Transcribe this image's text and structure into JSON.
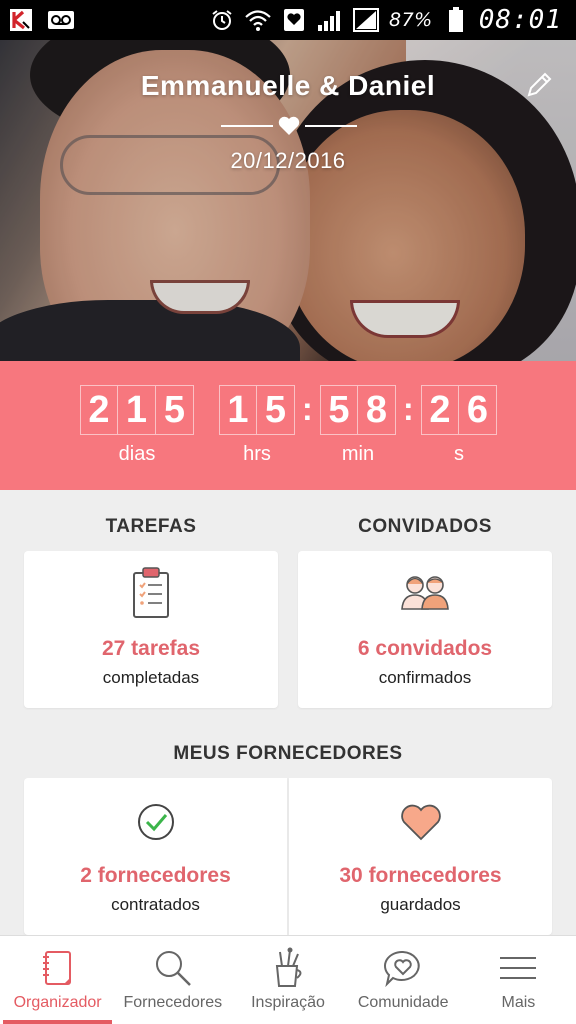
{
  "status_bar": {
    "battery": "87%",
    "time": "08:01"
  },
  "hero": {
    "couple_names": "Emmanuelle & Daniel",
    "wedding_date": "20/12/2016"
  },
  "countdown": {
    "days_digits": [
      "2",
      "1",
      "5"
    ],
    "hours_digits": [
      "1",
      "5"
    ],
    "minutes_digits": [
      "5",
      "8"
    ],
    "seconds_digits": [
      "2",
      "6"
    ],
    "labels": {
      "days": "dias",
      "hours": "hrs",
      "minutes": "min",
      "seconds": "s"
    },
    "separator": ":"
  },
  "tasks": {
    "title": "TAREFAS",
    "count_text": "27 tarefas",
    "sub_text": "completadas"
  },
  "guests": {
    "title": "CONVIDADOS",
    "count_text": "6 convidados",
    "sub_text": "confirmados"
  },
  "vendors": {
    "title": "MEUS FORNECEDORES",
    "hired": {
      "count_text": "2 fornecedores",
      "sub_text": "contratados"
    },
    "saved": {
      "count_text": "30 fornecedores",
      "sub_text": "guardados"
    }
  },
  "bottom_nav": {
    "items": [
      {
        "label": "Organizador",
        "icon": "notebook-icon",
        "active": true
      },
      {
        "label": "Fornecedores",
        "icon": "search-icon",
        "active": false
      },
      {
        "label": "Inspiração",
        "icon": "brushes-cup-icon",
        "active": false
      },
      {
        "label": "Comunidade",
        "icon": "chat-heart-icon",
        "active": false
      },
      {
        "label": "Mais",
        "icon": "menu-icon",
        "active": false
      }
    ]
  },
  "colors": {
    "accent": "#f7777e",
    "accent_text": "#e0656d",
    "active_nav": "#e45b62"
  }
}
